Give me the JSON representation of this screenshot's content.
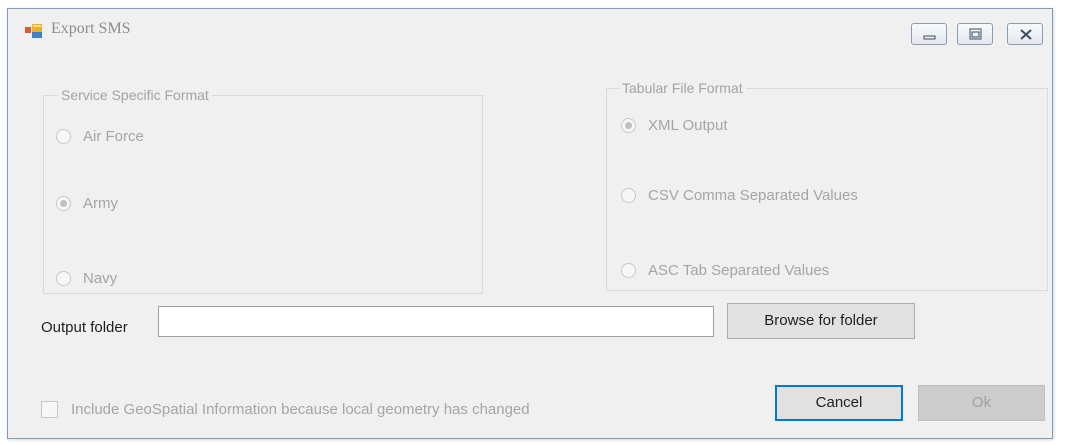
{
  "window": {
    "title": "Export SMS",
    "icon": "app-window-icon",
    "controls": {
      "minimize_icon": "minimize-icon",
      "restore_icon": "restore-icon",
      "close_icon": "close-icon"
    }
  },
  "service_format": {
    "label": "Service Specific Format",
    "options": [
      {
        "label": "Air Force",
        "selected": false
      },
      {
        "label": "Army",
        "selected": true
      },
      {
        "label": "Navy",
        "selected": false
      }
    ],
    "enabled": false
  },
  "tabular_format": {
    "label": "Tabular File Format",
    "options": [
      {
        "label": "XML Output",
        "selected": true
      },
      {
        "label": "CSV  Comma Separated Values",
        "selected": false
      },
      {
        "label": "ASC  Tab Separated Values",
        "selected": false
      }
    ],
    "enabled": false
  },
  "output": {
    "label": "Output folder",
    "value": "",
    "placeholder": ""
  },
  "buttons": {
    "browse": "Browse for folder",
    "cancel": "Cancel",
    "ok": "Ok"
  },
  "geospatial": {
    "label": "Include GeoSpatial Information because local geometry has changed",
    "checked": false,
    "enabled": false
  },
  "colors": {
    "focus_border": "#0078d7",
    "disabled_text": "#a5a5a5",
    "window_bg": "#f0f0f0"
  }
}
